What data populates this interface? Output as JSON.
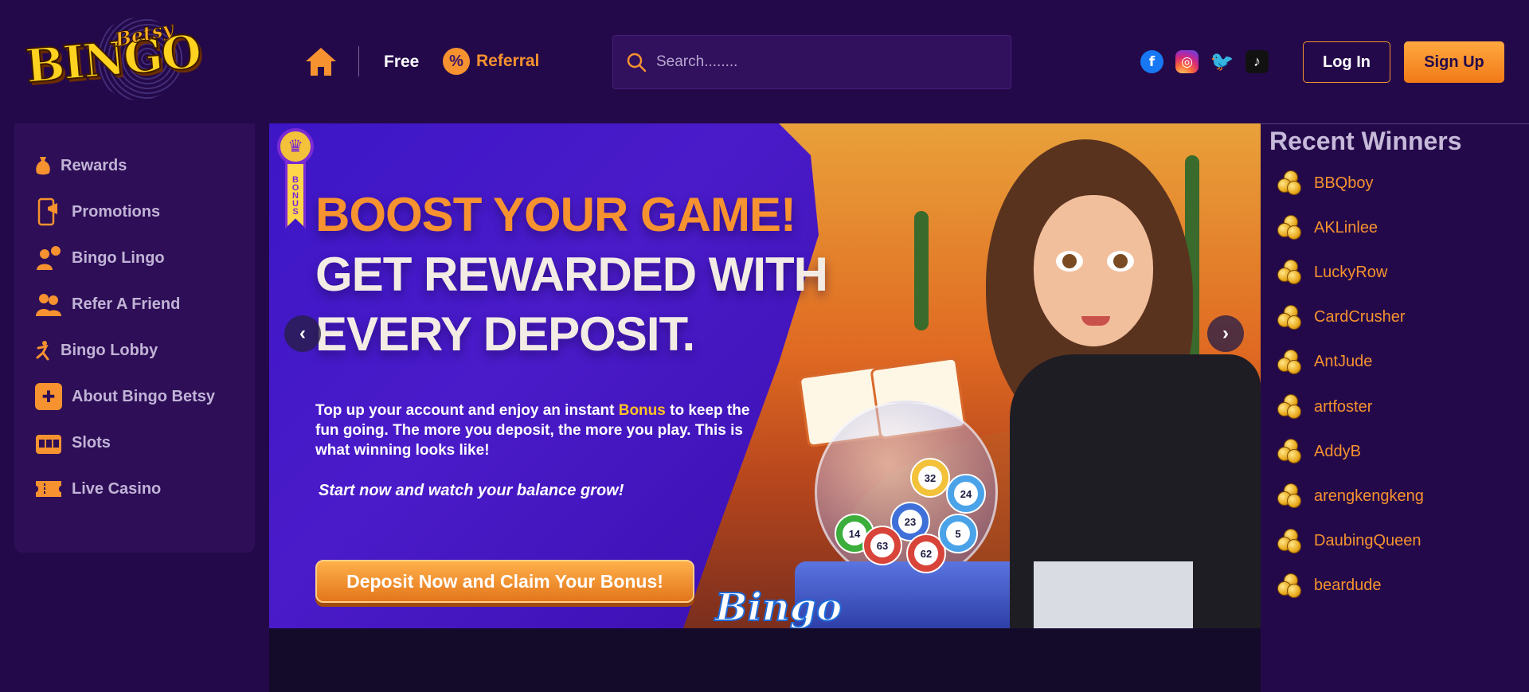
{
  "header": {
    "logo": {
      "wordmark": "BINGO",
      "sub": "Betsy"
    },
    "nav": {
      "free_label": "Free",
      "referral_label": "Referral",
      "referral_icon": "%"
    },
    "search": {
      "placeholder": "Search........"
    },
    "socials": [
      {
        "name": "facebook",
        "glyph": "f"
      },
      {
        "name": "instagram",
        "glyph": "◎"
      },
      {
        "name": "twitter",
        "glyph": "🐦"
      },
      {
        "name": "tiktok",
        "glyph": "♪"
      }
    ],
    "login_label": "Log In",
    "signup_label": "Sign Up"
  },
  "sidebar": {
    "items": [
      {
        "label": "Rewards",
        "icon": "money-bag-icon"
      },
      {
        "label": "Promotions",
        "icon": "phone-megaphone-icon"
      },
      {
        "label": "Bingo Lingo",
        "icon": "person-chat-icon"
      },
      {
        "label": "Refer A Friend",
        "icon": "people-icon"
      },
      {
        "label": "Bingo Lobby",
        "icon": "running-figure-icon"
      },
      {
        "label": "About Bingo Betsy",
        "icon": "gift-icon"
      },
      {
        "label": "Slots",
        "icon": "slot-machine-icon"
      },
      {
        "label": "Live Casino",
        "icon": "ticket-icon"
      }
    ]
  },
  "banner": {
    "badge_text": "BONUS",
    "headline_1": "BOOST YOUR GAME!",
    "headline_2": "GET REWARDED WITH",
    "headline_3": "EVERY DEPOSIT.",
    "body_before": "Top up your account and enjoy an instant ",
    "body_highlight": "Bonus",
    "body_after": " to keep the fun going. The more you deposit, the more you play. This is what winning looks like!",
    "tagline": "Start now and watch your balance grow!",
    "cta_label": "Deposit Now and Claim Your Bonus!",
    "prev_label": "‹",
    "next_label": "›",
    "balls": [
      "32",
      "24",
      "23",
      "14",
      "63",
      "62",
      "5"
    ],
    "bingo_script": "Bingo"
  },
  "winners": {
    "title": "Recent Winners",
    "names": [
      "BBQboy",
      "AKLinlee",
      "LuckyRow",
      "CardCrusher",
      "AntJude",
      "artfoster",
      "AddyB",
      "arengkengkeng",
      "DaubingQueen",
      "beardude"
    ]
  },
  "colors": {
    "background": "#24094a",
    "accent": "#f6922f",
    "sidebar": "#2d0e57"
  }
}
